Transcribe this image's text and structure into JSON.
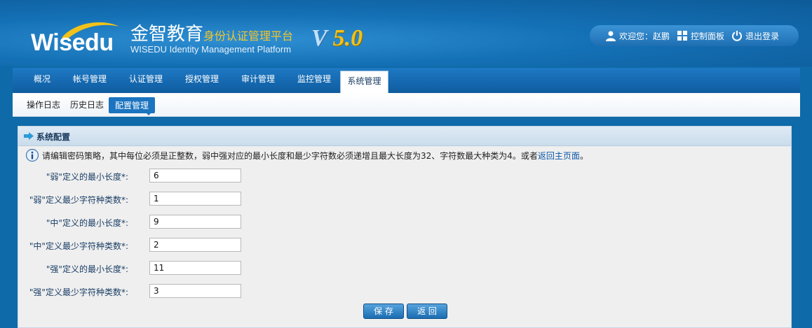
{
  "brand": {
    "logo_text": "Wisedu",
    "name_cn": "金智教育",
    "name_cn_sub": "身份认证管理平台",
    "name_en": "WISEDU Identity Management Platform",
    "version_v": "V",
    "version_num": "5.0"
  },
  "userbar": {
    "welcome": "欢迎您：赵鹏",
    "control_panel": "控制面板",
    "logout": "退出登录"
  },
  "main_nav": [
    {
      "label": "概况"
    },
    {
      "label": "帐号管理"
    },
    {
      "label": "认证管理"
    },
    {
      "label": "授权管理"
    },
    {
      "label": "审计管理"
    },
    {
      "label": "监控管理"
    },
    {
      "label": "系统管理",
      "active": true
    }
  ],
  "sub_nav": [
    {
      "label": "操作日志"
    },
    {
      "label": "历史日志"
    },
    {
      "label": "配置管理",
      "active": true
    }
  ],
  "panel": {
    "title": "系统配置",
    "notice_text": "请编辑密码策略，其中每位必须是正整数，弱中强对应的最小长度和最少字符数必须递增且最大长度为32、字符数最大种类为4。或者",
    "notice_link": "返回主页面",
    "notice_end": "。"
  },
  "fields": [
    {
      "label": "\"弱\"定义的最小长度*:",
      "value": "6"
    },
    {
      "label": "\"弱\"定义最少字符种类数*:",
      "value": "1"
    },
    {
      "label": "\"中\"定义的最小长度*:",
      "value": "9"
    },
    {
      "label": "\"中\"定义最少字符种类数*:",
      "value": "2"
    },
    {
      "label": "\"强\"定义的最小长度*:",
      "value": "11"
    },
    {
      "label": "\"强\"定义最少字符种类数*:",
      "value": "3"
    }
  ],
  "buttons": {
    "save": "保 存",
    "back": "返 回"
  },
  "colors": {
    "header_blue": "#1470b5",
    "accent_gold": "#f1c21c",
    "nav_blue": "#1e79c4",
    "link_blue": "#0b57a8"
  }
}
